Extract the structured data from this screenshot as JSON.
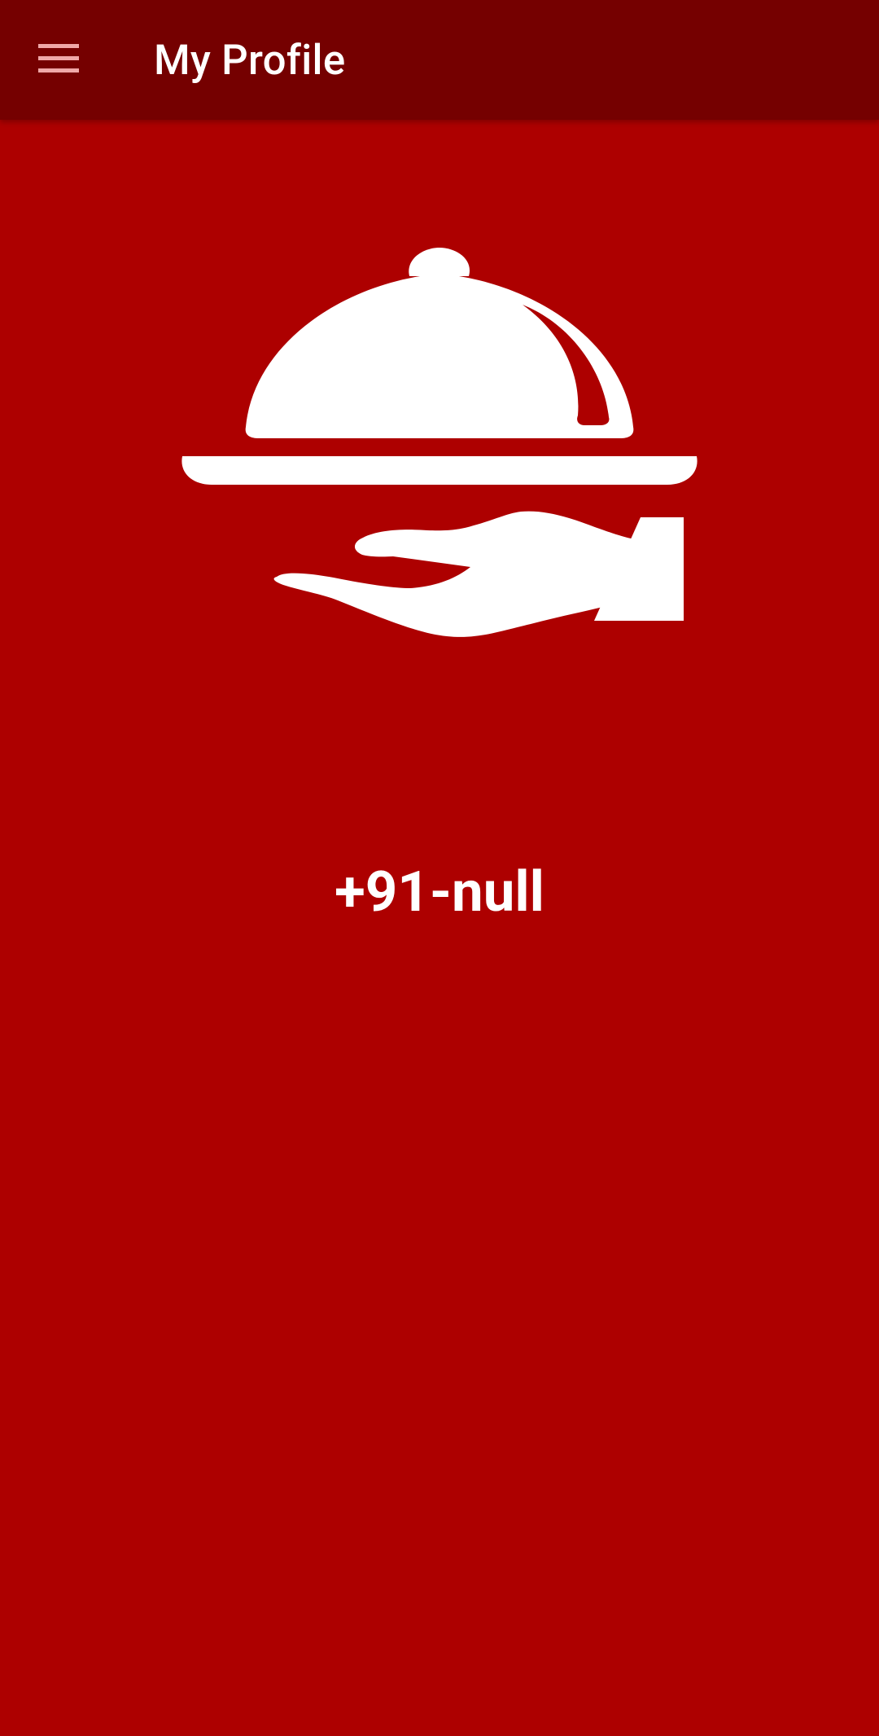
{
  "app_bar": {
    "title": "My Profile",
    "menu_icon": "hamburger-menu-icon",
    "background": "#750000"
  },
  "profile": {
    "logo_icon": "food-serving-cloche-icon",
    "phone": "+91-null"
  },
  "colors": {
    "background": "#AD0000",
    "text": "#FFFFFF",
    "menu_icon": "#F0A8A8"
  }
}
